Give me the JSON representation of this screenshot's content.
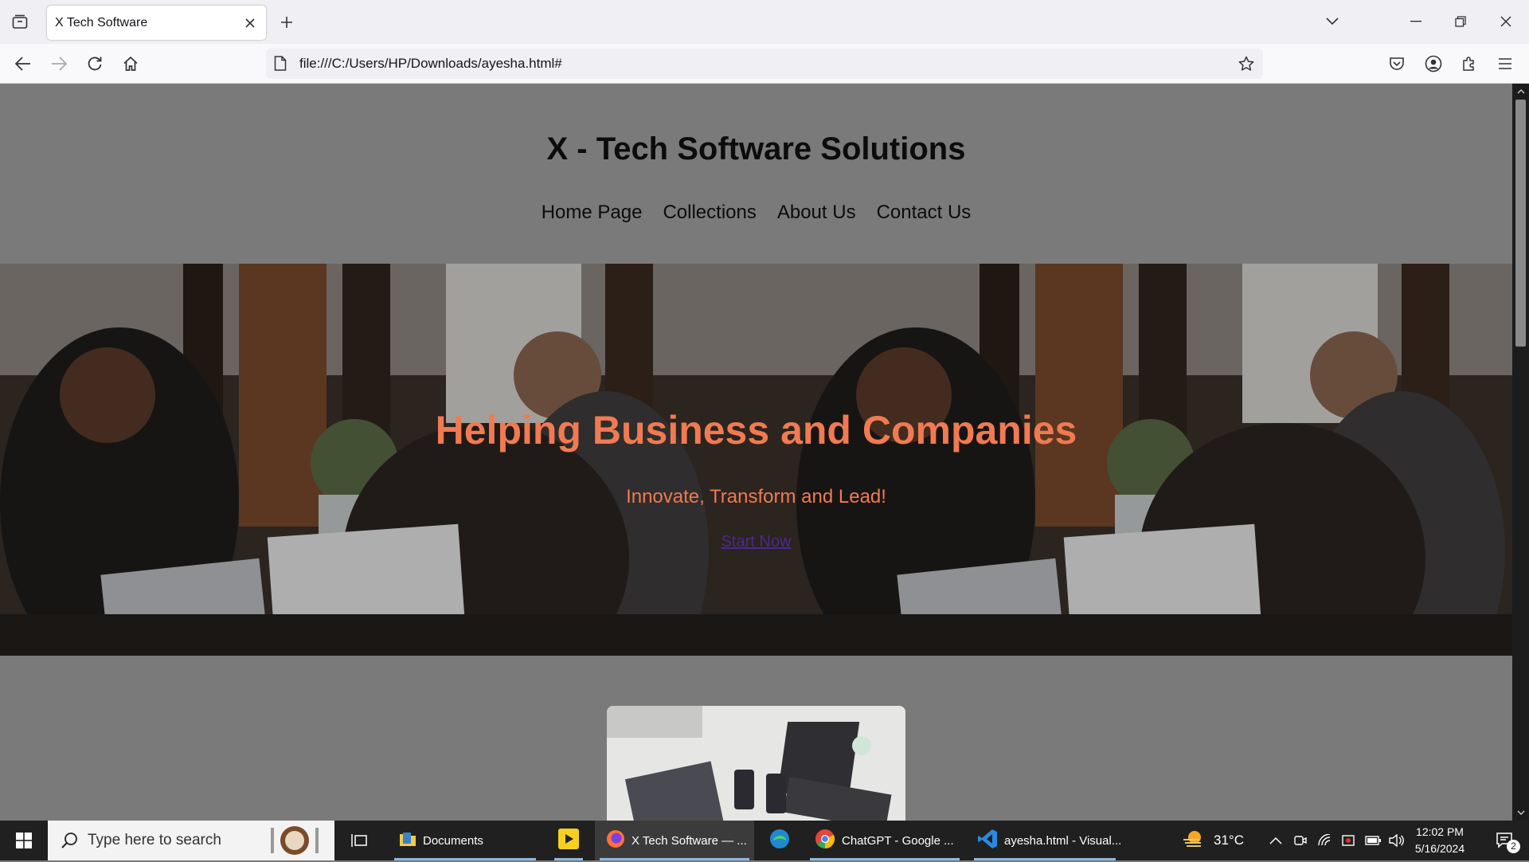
{
  "browser": {
    "tab_title": "X Tech Software",
    "url": "file:///C:/Users/HP/Downloads/ayesha.html#"
  },
  "site": {
    "title": "X - Tech Software Solutions",
    "nav": [
      {
        "label": "Home Page"
      },
      {
        "label": "Collections"
      },
      {
        "label": "About Us"
      },
      {
        "label": "Contact Us"
      }
    ],
    "hero": {
      "heading": "Helping Business and Companies",
      "subheading": "Innovate, Transform and Lead!",
      "cta": "Start Now"
    }
  },
  "taskbar": {
    "search_placeholder": "Type here to search",
    "apps": [
      {
        "label": "Documents",
        "icon": "folder-icon"
      },
      {
        "label": "",
        "icon": "player-icon"
      },
      {
        "label": "X Tech Software — ...",
        "icon": "firefox-icon"
      },
      {
        "label": "",
        "icon": "edge-icon"
      },
      {
        "label": "ChatGPT - Google ...",
        "icon": "chrome-icon"
      },
      {
        "label": "ayesha.html - Visual...",
        "icon": "vscode-icon"
      }
    ],
    "weather": "31°C",
    "time": "12:02 PM",
    "date": "5/16/2024",
    "notifications": "2"
  },
  "colors": {
    "page_bg": "#7a7a7a",
    "hero_text": "#f07a52",
    "link": "#4a2a8c"
  }
}
